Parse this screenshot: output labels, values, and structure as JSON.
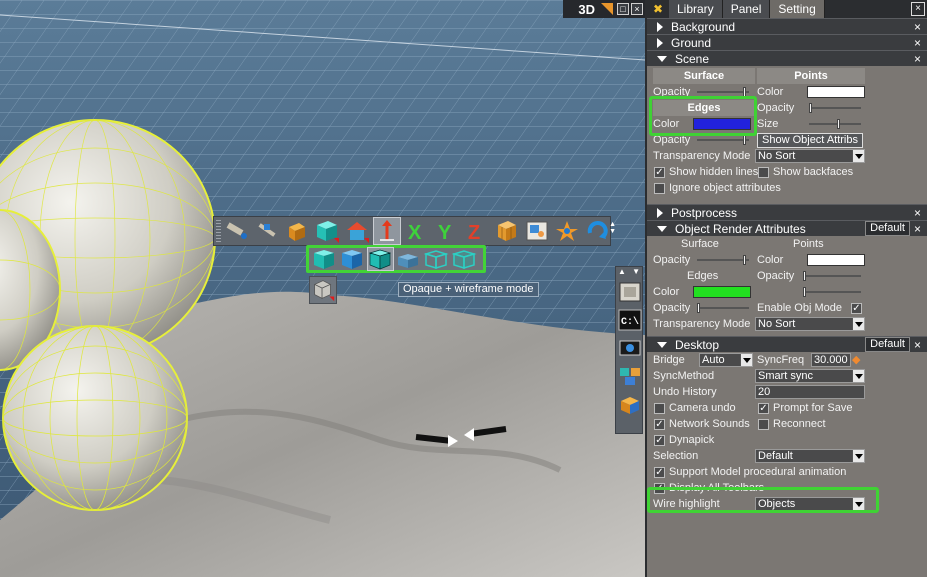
{
  "viewport": {
    "label": "3D",
    "buttons": [
      "□",
      "×"
    ],
    "tooltip": "Opaque + wireframe mode",
    "side_toolbar_header": [
      "▲",
      "▼"
    ],
    "icons": [
      "paint-icon",
      "hammer-icon",
      "box-icon",
      "cube-icon",
      "house-icon",
      "move-arrow-icon",
      "x-axis-icon",
      "y-axis-icon",
      "z-axis-icon",
      "grid-box-icon",
      "image-icon",
      "star-icon",
      "rotate-icon"
    ],
    "sub_icons": [
      "solid-cube-icon",
      "shaded-cube-icon",
      "opaque-wire-cube-icon",
      "flat-cube-icon",
      "wire-cube-icon",
      "transparent-wire-cube-icon"
    ],
    "side_icons": [
      "frame-icon",
      "console-icon",
      "camera-icon",
      "cubes-icon",
      "render-icon"
    ],
    "console_glyph": "C:\\"
  },
  "panel": {
    "tabs": [
      "Library",
      "Panel",
      "Setting"
    ],
    "active_tab": "Setting",
    "close": "×",
    "sections": {
      "background": "Background",
      "ground": "Ground",
      "scene": "Scene",
      "postprocess": "Postprocess",
      "object_render": "Object Render Attributes",
      "desktop": "Desktop"
    },
    "default_label": "Default",
    "scene": {
      "surface": "Surface",
      "points": "Points",
      "opacity": "Opacity",
      "color": "Color",
      "edges": "Edges",
      "size": "Size",
      "show_object_attribs": "Show Object Attribs",
      "transparency_mode": "Transparency Mode",
      "no_sort": "No Sort",
      "show_hidden_lines": "Show hidden lines",
      "show_backfaces": "Show backfaces",
      "ignore_object_attributes": "Ignore object attributes"
    },
    "object_render": {
      "surface": "Surface",
      "points": "Points",
      "opacity": "Opacity",
      "color": "Color",
      "edges": "Edges",
      "enable_obj_mode": "Enable Obj Mode",
      "transparency_mode": "Transparency Mode",
      "no_sort": "No Sort"
    },
    "desktop": {
      "bridge": "Bridge",
      "bridge_value": "Auto",
      "syncfreq": "SyncFreq",
      "syncfreq_value": "30.000",
      "syncmethod": "SyncMethod",
      "syncmethod_value": "Smart sync",
      "undo_history": "Undo History",
      "undo_history_value": "20",
      "camera_undo": "Camera undo",
      "prompt_for_save": "Prompt for Save",
      "network_sounds": "Network Sounds",
      "reconnect": "Reconnect",
      "dynapick": "Dynapick",
      "selection": "Selection",
      "selection_value": "Default",
      "support_model": "Support Model procedural animation",
      "display_all_toolbars": "Display All Toolbars",
      "wire_highlight": "Wire highlight",
      "wire_highlight_value": "Objects"
    },
    "check": "✓"
  },
  "colors": {
    "edges_blue": "#2222dd",
    "edges_green": "#22e020",
    "highlight_green": "#3fd234"
  }
}
